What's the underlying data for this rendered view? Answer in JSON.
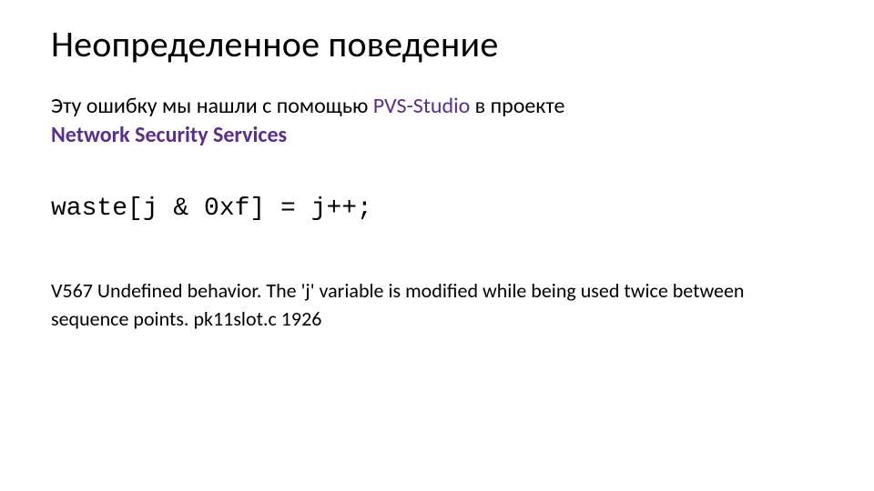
{
  "title": "Неопределенное поведение",
  "intro_prefix": "Эту ошибку мы нашли с помощью ",
  "tool": "PVS-Studio",
  "intro_middle": " в проекте ",
  "project": "Network Security Services",
  "code": "waste[j & 0xf] = j++;",
  "diagnostic": "V567 Undefined behavior. The 'j' variable is modified while being used twice between sequence points. pk11slot.c 1926"
}
